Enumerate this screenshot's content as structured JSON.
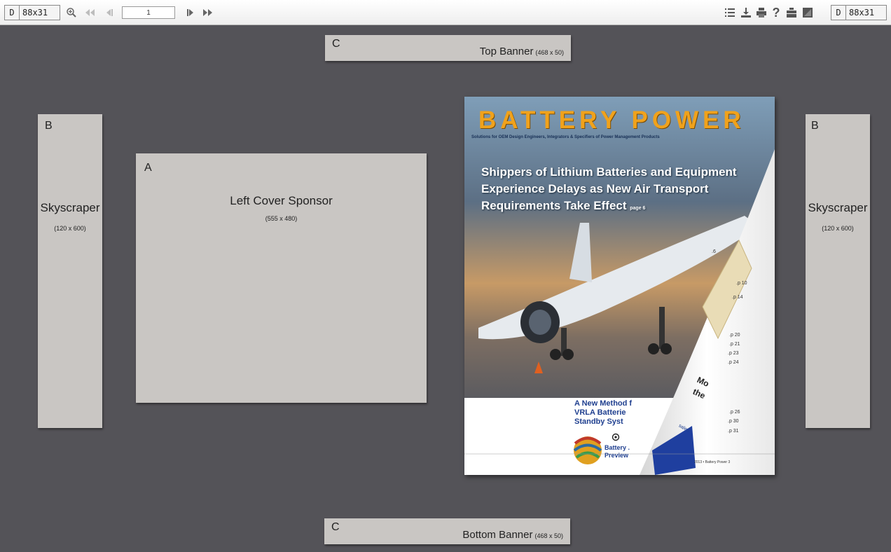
{
  "toolbar": {
    "left_badge": {
      "d": "D",
      "size": "88x31"
    },
    "right_badge": {
      "d": "D",
      "size": "88x31"
    },
    "page_number": "1",
    "icons": [
      "zoom-in-icon",
      "first-page-icon",
      "prev-page-icon",
      "next-page-icon",
      "last-page-icon",
      "contents-icon",
      "download-icon",
      "print-icon",
      "help-icon",
      "share-icon",
      "fullscreen-icon"
    ]
  },
  "top_banner": {
    "letter": "C",
    "title": "Top Banner",
    "size": "(468 x 50)"
  },
  "bottom_banner": {
    "letter": "C",
    "title": "Bottom Banner",
    "size": "(468 x 50)"
  },
  "left_skyscraper": {
    "letter": "B",
    "title": "Skyscraper",
    "size": "(120 x 600)"
  },
  "right_skyscraper": {
    "letter": "B",
    "title": "Skyscraper",
    "size": "(120 x 600)"
  },
  "left_cover": {
    "letter": "A",
    "title": "Left Cover Sponsor",
    "size": "(555 x 480)"
  },
  "magazine": {
    "masthead": "BATTERY POWER",
    "tagline": "Solutions for OEM Design Engineers, Integrators & Specifiers of Power Management Products",
    "headline_1": "Shippers of Lithium Batteries and Equipment",
    "headline_2": "Experience Delays as New Air Transport",
    "headline_3": "Requirements Take Effect",
    "headline_page": "page 6",
    "sub_1": "A New Method f",
    "sub_2": "VRLA Batterie",
    "sub_3": "Standby Syst",
    "logo_1": "Battery .",
    "logo_2": "Preview",
    "toc_pages": [
      ".6",
      ".p 10",
      ".p 14",
      ".p 20",
      ".p 21",
      ".p 23",
      ".p 24",
      ".p 26",
      ".p 30",
      ".p 31"
    ],
    "peel_more": "Mo",
    "peel_the": "the",
    "peel_sales": "sales",
    "footer": "2013 • Battery Power   3",
    "colors": {
      "masthead": "#f0a21c",
      "subhead": "#1f3f8f"
    }
  }
}
